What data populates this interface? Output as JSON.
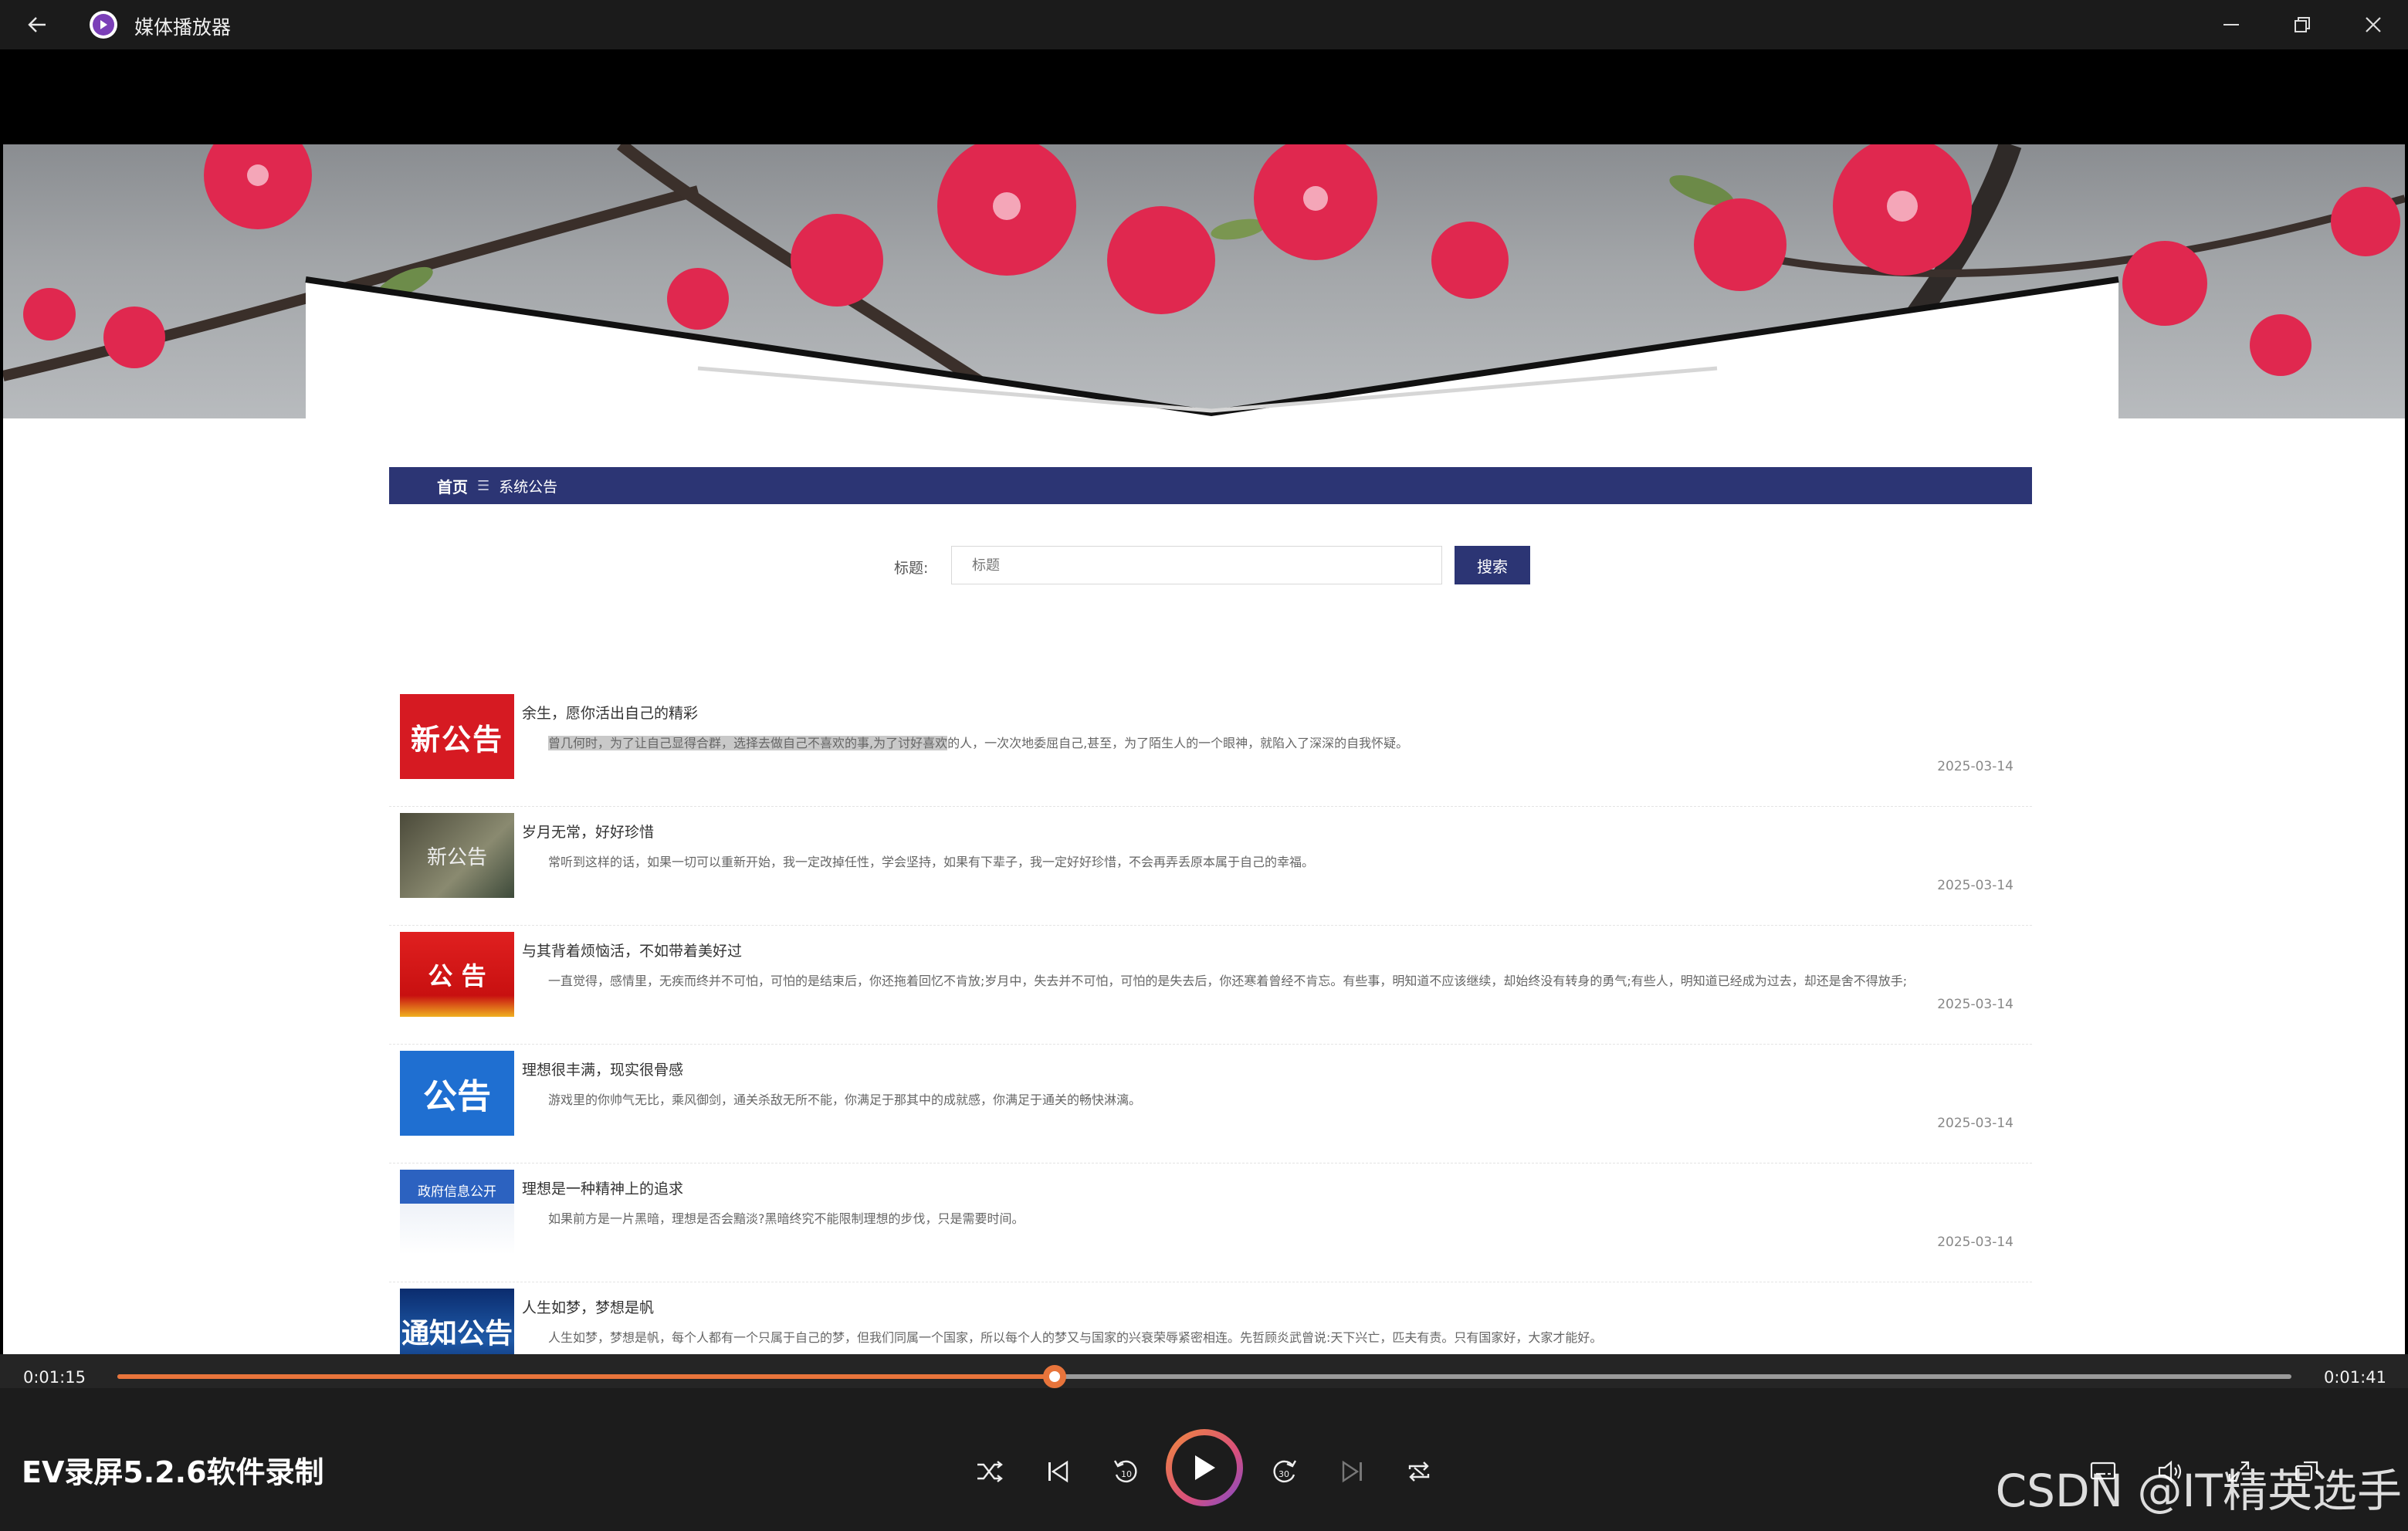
{
  "app": {
    "title": "媒体播放器",
    "icons": {
      "back": "back-arrow-icon",
      "app": "media-player-icon",
      "minimize": "minimize-icon",
      "maximize": "restore-icon",
      "close": "close-icon"
    }
  },
  "site": {
    "breadcrumb": {
      "home": "首页",
      "separator": "☰",
      "current": "系统公告"
    },
    "search": {
      "label": "标题:",
      "placeholder": "标题",
      "button": "搜索"
    },
    "items": [
      {
        "thumb": "新公告",
        "title": "余生，愿你活出自己的精彩",
        "desc_highlight": "曾几何时，为了让自己显得合群，选择去做自己不喜欢的事,为了讨好喜欢",
        "desc_rest": "的人，一次次地委屈自己,甚至，为了陌生人的一个眼神，就陷入了深深的自我怀疑。",
        "date": "2025-03-14"
      },
      {
        "thumb": "新公告",
        "title": "岁月无常，好好珍惜",
        "desc_highlight": "",
        "desc_rest": "常听到这样的话，如果一切可以重新开始，我一定改掉任性，学会坚持，如果有下辈子，我一定好好珍惜，不会再弄丢原本属于自己的幸福。",
        "date": "2025-03-14"
      },
      {
        "thumb": "公 告",
        "title": "与其背着烦恼活，不如带着美好过",
        "desc_highlight": "",
        "desc_rest": "一直觉得，感情里，无疾而终并不可怕，可怕的是结束后，你还拖着回忆不肯放;岁月中，失去并不可怕，可怕的是失去后，你还寒着曾经不肯忘。有些事，明知道不应该继续，却始终没有转身的勇气;有些人，明知道已经成为过去，却还是舍不得放手;",
        "date": "2025-03-14"
      },
      {
        "thumb": "公告",
        "title": "理想很丰满，现实很骨感",
        "desc_highlight": "",
        "desc_rest": "游戏里的你帅气无比，乘风御剑，通关杀敌无所不能，你满足于那其中的成就感，你满足于通关的畅快淋漓。",
        "date": "2025-03-14"
      },
      {
        "thumb": "政府信息公开",
        "title": "理想是一种精神上的追求",
        "desc_highlight": "",
        "desc_rest": "如果前方是一片黑暗，理想是否会黯淡?黑暗终究不能限制理想的步伐，只是需要时间。",
        "date": "2025-03-14"
      },
      {
        "thumb": "通知公告",
        "title": "人生如梦，梦想是帆",
        "desc_highlight": "",
        "desc_rest": "人生如梦，梦想是帆，每个人都有一个只属于自己的梦，但我们同属一个国家，所以每个人的梦又与国家的兴衰荣辱紧密相连。先哲顾炎武曾说:天下兴亡，匹夫有责。只有国家好，大家才能好。",
        "date": "2025-03-14"
      }
    ]
  },
  "player": {
    "current_time": "0:01:15",
    "total_time": "0:01:41",
    "progress": 0.431,
    "now_playing": "EV录屏5.2.6软件录制",
    "accent": "#e8743b",
    "icons": [
      "shuffle-icon",
      "previous-icon",
      "rewind-10-icon",
      "play-icon",
      "forward-30-icon",
      "next-icon",
      "repeat-icon",
      "subtitles-icon",
      "volume-icon",
      "fullscreen-icon",
      "mini-view-icon"
    ]
  },
  "watermark": "CSDN @IT精英选手"
}
